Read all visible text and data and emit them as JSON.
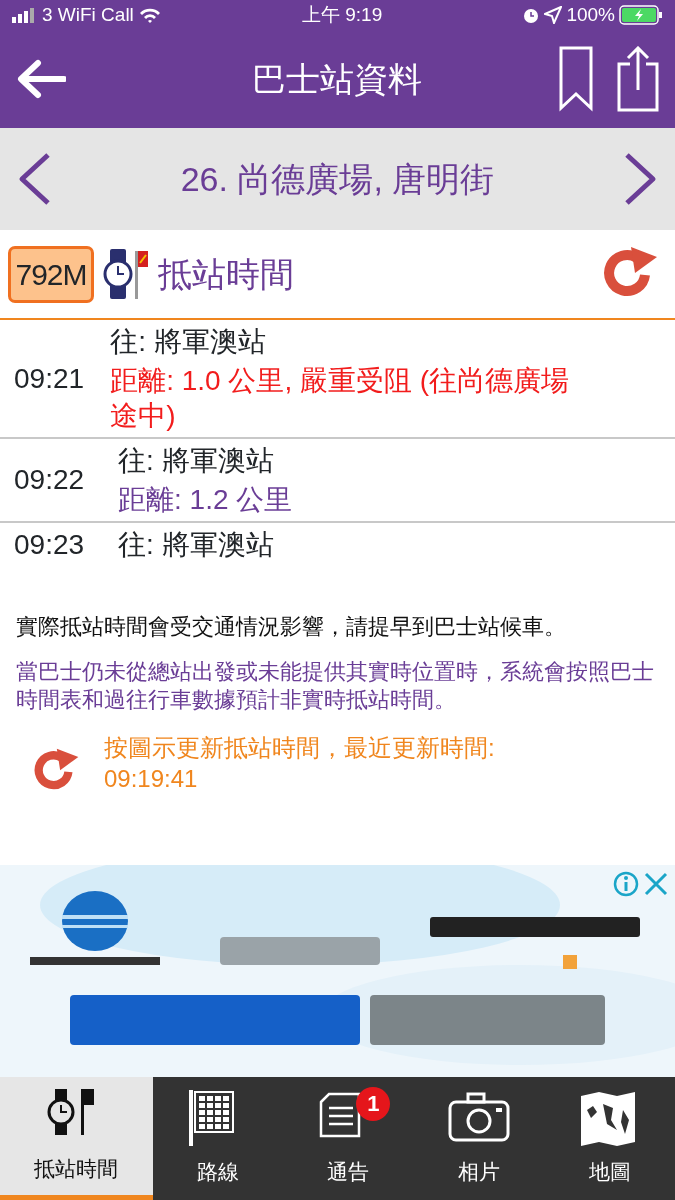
{
  "status_bar": {
    "carrier": "3 WiFi Call",
    "time": "上午 9:19",
    "battery": "100%"
  },
  "header": {
    "title": "巴士站資料"
  },
  "stop_bar": {
    "title": "26. 尚德廣場, 唐明街"
  },
  "route": {
    "number": "792M",
    "section_title": "抵站時間"
  },
  "arrivals": [
    {
      "time": "09:21",
      "destination": "往: 將軍澳站",
      "distance": "距離: 1.0 公里, 嚴重受阻 (往尚德廣場途中)",
      "kind": "congested"
    },
    {
      "time": "09:22",
      "destination": "往: 將軍澳站",
      "distance": "距離: 1.2 公里",
      "kind": "normal"
    },
    {
      "time": "09:23",
      "destination": "往: 將軍澳站"
    }
  ],
  "notes": [
    {
      "text": "實際抵站時間會受交通情況影響，請提早到巴士站候車。",
      "kind": "plain"
    },
    {
      "text": "當巴士仍未從總站出發或未能提供其實時位置時，系統會按照巴士時間表和過往行車數據預計非實時抵站時間。",
      "kind": "estimate"
    }
  ],
  "refresh_note": "按圖示更新抵站時間，最近更新時間: 09:19:41",
  "tabs": [
    {
      "label": "抵站時間",
      "selected": true,
      "kind": "watch"
    },
    {
      "label": "路線",
      "selected": false,
      "kind": "grid"
    },
    {
      "label": "通告",
      "selected": false,
      "kind": "notice",
      "badge": "1"
    },
    {
      "label": "相片",
      "selected": false,
      "kind": "camera"
    },
    {
      "label": "地圖",
      "selected": false,
      "kind": "map"
    }
  ]
}
